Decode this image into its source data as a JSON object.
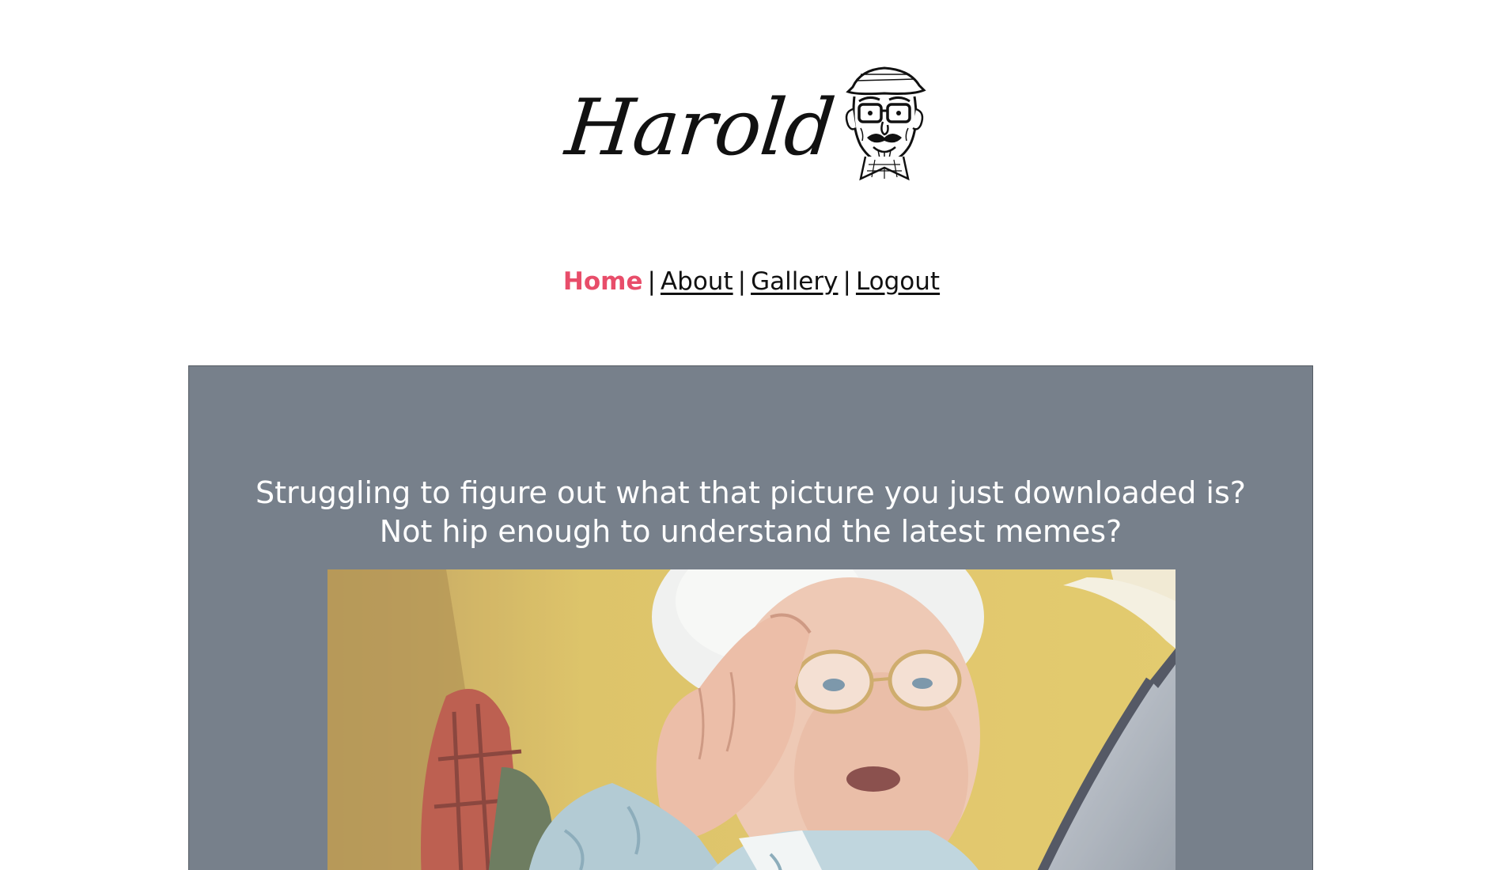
{
  "logo": {
    "wordmark": "Harold",
    "mascot_icon": "old-man-cartoon-icon"
  },
  "nav": {
    "items": [
      {
        "label": "Home",
        "active": true
      },
      {
        "label": "About",
        "active": false
      },
      {
        "label": "Gallery",
        "active": false
      },
      {
        "label": "Logout",
        "active": false
      }
    ],
    "separator": "|"
  },
  "hero": {
    "tagline": "Struggling to figure out what that picture you just downloaded is? Not hip enough to understand the latest memes?"
  },
  "colors": {
    "active_link": "#e84d6a",
    "panel_bg": "#77808b",
    "text": "#111111"
  }
}
